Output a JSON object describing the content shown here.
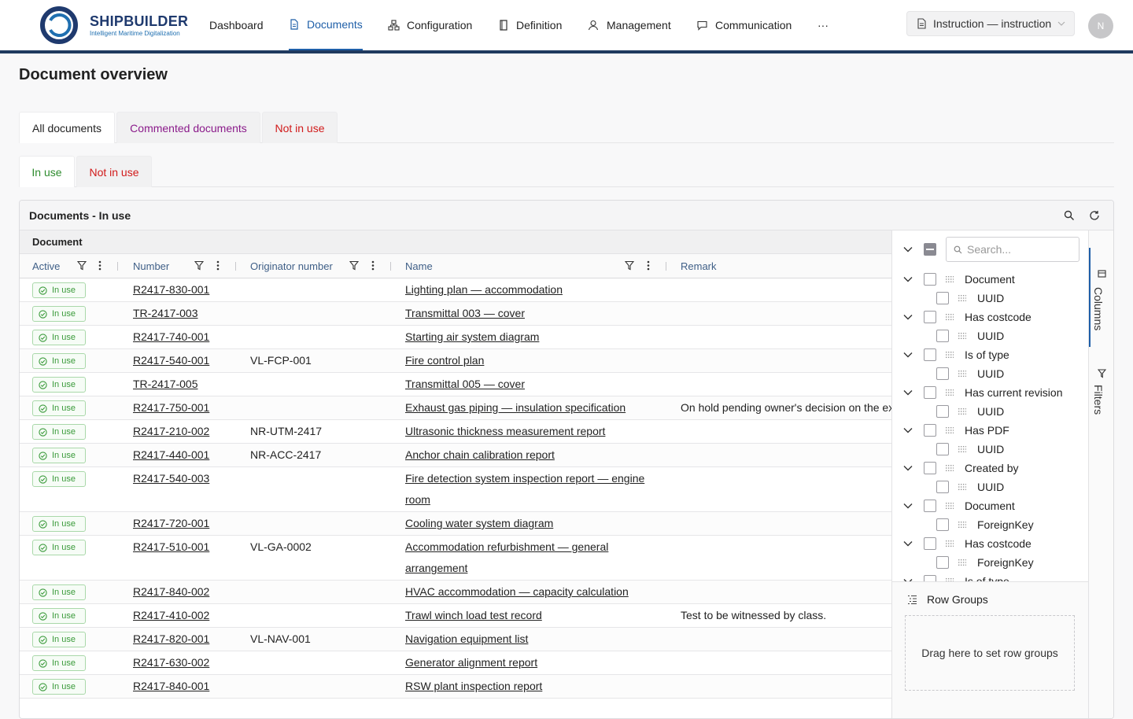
{
  "brand": {
    "name": "SHIPBUILDER",
    "tagline": "Intelligent Maritime Digitalization"
  },
  "nav": [
    {
      "label": "Dashboard",
      "icon": "none"
    },
    {
      "label": "Documents",
      "icon": "document-icon",
      "active": true
    },
    {
      "label": "Configuration",
      "icon": "hierarchy-icon"
    },
    {
      "label": "Definition",
      "icon": "book-icon"
    },
    {
      "label": "Management",
      "icon": "user-icon"
    },
    {
      "label": "Communication",
      "icon": "chat-icon"
    },
    {
      "label": "···",
      "icon": "more-icon"
    }
  ],
  "instruction_label": "Instruction — instruction",
  "avatar_initial": "N",
  "page_title": "Document overview",
  "tabs_primary": [
    {
      "label": "All documents",
      "color": "#222222"
    },
    {
      "label": "Commented documents",
      "color": "#8a1a8a"
    },
    {
      "label": "Not in use",
      "color": "#d11a1a"
    }
  ],
  "tabs_secondary": [
    {
      "label": "In use",
      "color": "#2e8b2e"
    },
    {
      "label": "Not in use",
      "color": "#d11a1a"
    }
  ],
  "grid": {
    "title": "Documents - In use",
    "group_header": "Document",
    "columns": [
      "Active",
      "Number",
      "Originator number",
      "Name",
      "Remark"
    ],
    "badge_label": "In use",
    "rows": [
      {
        "number": "R2417-830-001",
        "originator": "",
        "name": "Lighting plan — accommodation",
        "remark": ""
      },
      {
        "number": "TR-2417-003",
        "originator": "",
        "name": "Transmittal 003 — cover",
        "remark": ""
      },
      {
        "number": "R2417-740-001",
        "originator": "",
        "name": "Starting air system diagram",
        "remark": ""
      },
      {
        "number": "R2417-540-001",
        "originator": "VL-FCP-001",
        "name": "Fire control plan",
        "remark": ""
      },
      {
        "number": "TR-2417-005",
        "originator": "",
        "name": "Transmittal 005 — cover",
        "remark": ""
      },
      {
        "number": "R2417-750-001",
        "originator": "",
        "name": "Exhaust gas piping — insulation specification",
        "remark": "On hold pending owner's decision on the ex"
      },
      {
        "number": "R2417-210-002",
        "originator": "NR-UTM-2417",
        "name": "Ultrasonic thickness measurement report",
        "remark": ""
      },
      {
        "number": "R2417-440-001",
        "originator": "NR-ACC-2417",
        "name": "Anchor chain calibration report",
        "remark": ""
      },
      {
        "number": "R2417-540-003",
        "originator": "",
        "name": "Fire detection system inspection report — engine room",
        "remark": ""
      },
      {
        "number": "R2417-720-001",
        "originator": "",
        "name": "Cooling water system diagram",
        "remark": ""
      },
      {
        "number": "R2417-510-001",
        "originator": "VL-GA-0002",
        "name": "Accommodation refurbishment — general arrangement",
        "remark": ""
      },
      {
        "number": "R2417-840-002",
        "originator": "",
        "name": "HVAC accommodation — capacity calculation",
        "remark": ""
      },
      {
        "number": "R2417-410-002",
        "originator": "",
        "name": "Trawl winch load test record",
        "remark": "Test to be witnessed by class."
      },
      {
        "number": "R2417-820-001",
        "originator": "VL-NAV-001",
        "name": "Navigation equipment list",
        "remark": ""
      },
      {
        "number": "R2417-630-002",
        "originator": "",
        "name": "Generator alignment report",
        "remark": ""
      },
      {
        "number": "R2417-840-001",
        "originator": "",
        "name": "RSW plant inspection report",
        "remark": ""
      }
    ]
  },
  "side_panel": {
    "search_placeholder": "Search...",
    "tree": [
      {
        "label": "Document",
        "level": 0
      },
      {
        "label": "UUID",
        "level": 1
      },
      {
        "label": "Has costcode",
        "level": 0
      },
      {
        "label": "UUID",
        "level": 1
      },
      {
        "label": "Is of type",
        "level": 0
      },
      {
        "label": "UUID",
        "level": 1
      },
      {
        "label": "Has current revision",
        "level": 0
      },
      {
        "label": "UUID",
        "level": 1
      },
      {
        "label": "Has PDF",
        "level": 0
      },
      {
        "label": "UUID",
        "level": 1
      },
      {
        "label": "Created by",
        "level": 0
      },
      {
        "label": "UUID",
        "level": 1
      },
      {
        "label": "Document",
        "level": 0
      },
      {
        "label": "ForeignKey",
        "level": 1
      },
      {
        "label": "Has costcode",
        "level": 0
      },
      {
        "label": "ForeignKey",
        "level": 1
      },
      {
        "label": "Is of type",
        "level": 0
      }
    ],
    "row_groups_label": "Row Groups",
    "row_groups_drop": "Drag here to set row groups",
    "tab_columns": "Columns",
    "tab_filters": "Filters"
  },
  "colors": {
    "accent": "#1f5fa8",
    "brand": "#1f3a6e",
    "in_use": "#3a9a3a"
  }
}
